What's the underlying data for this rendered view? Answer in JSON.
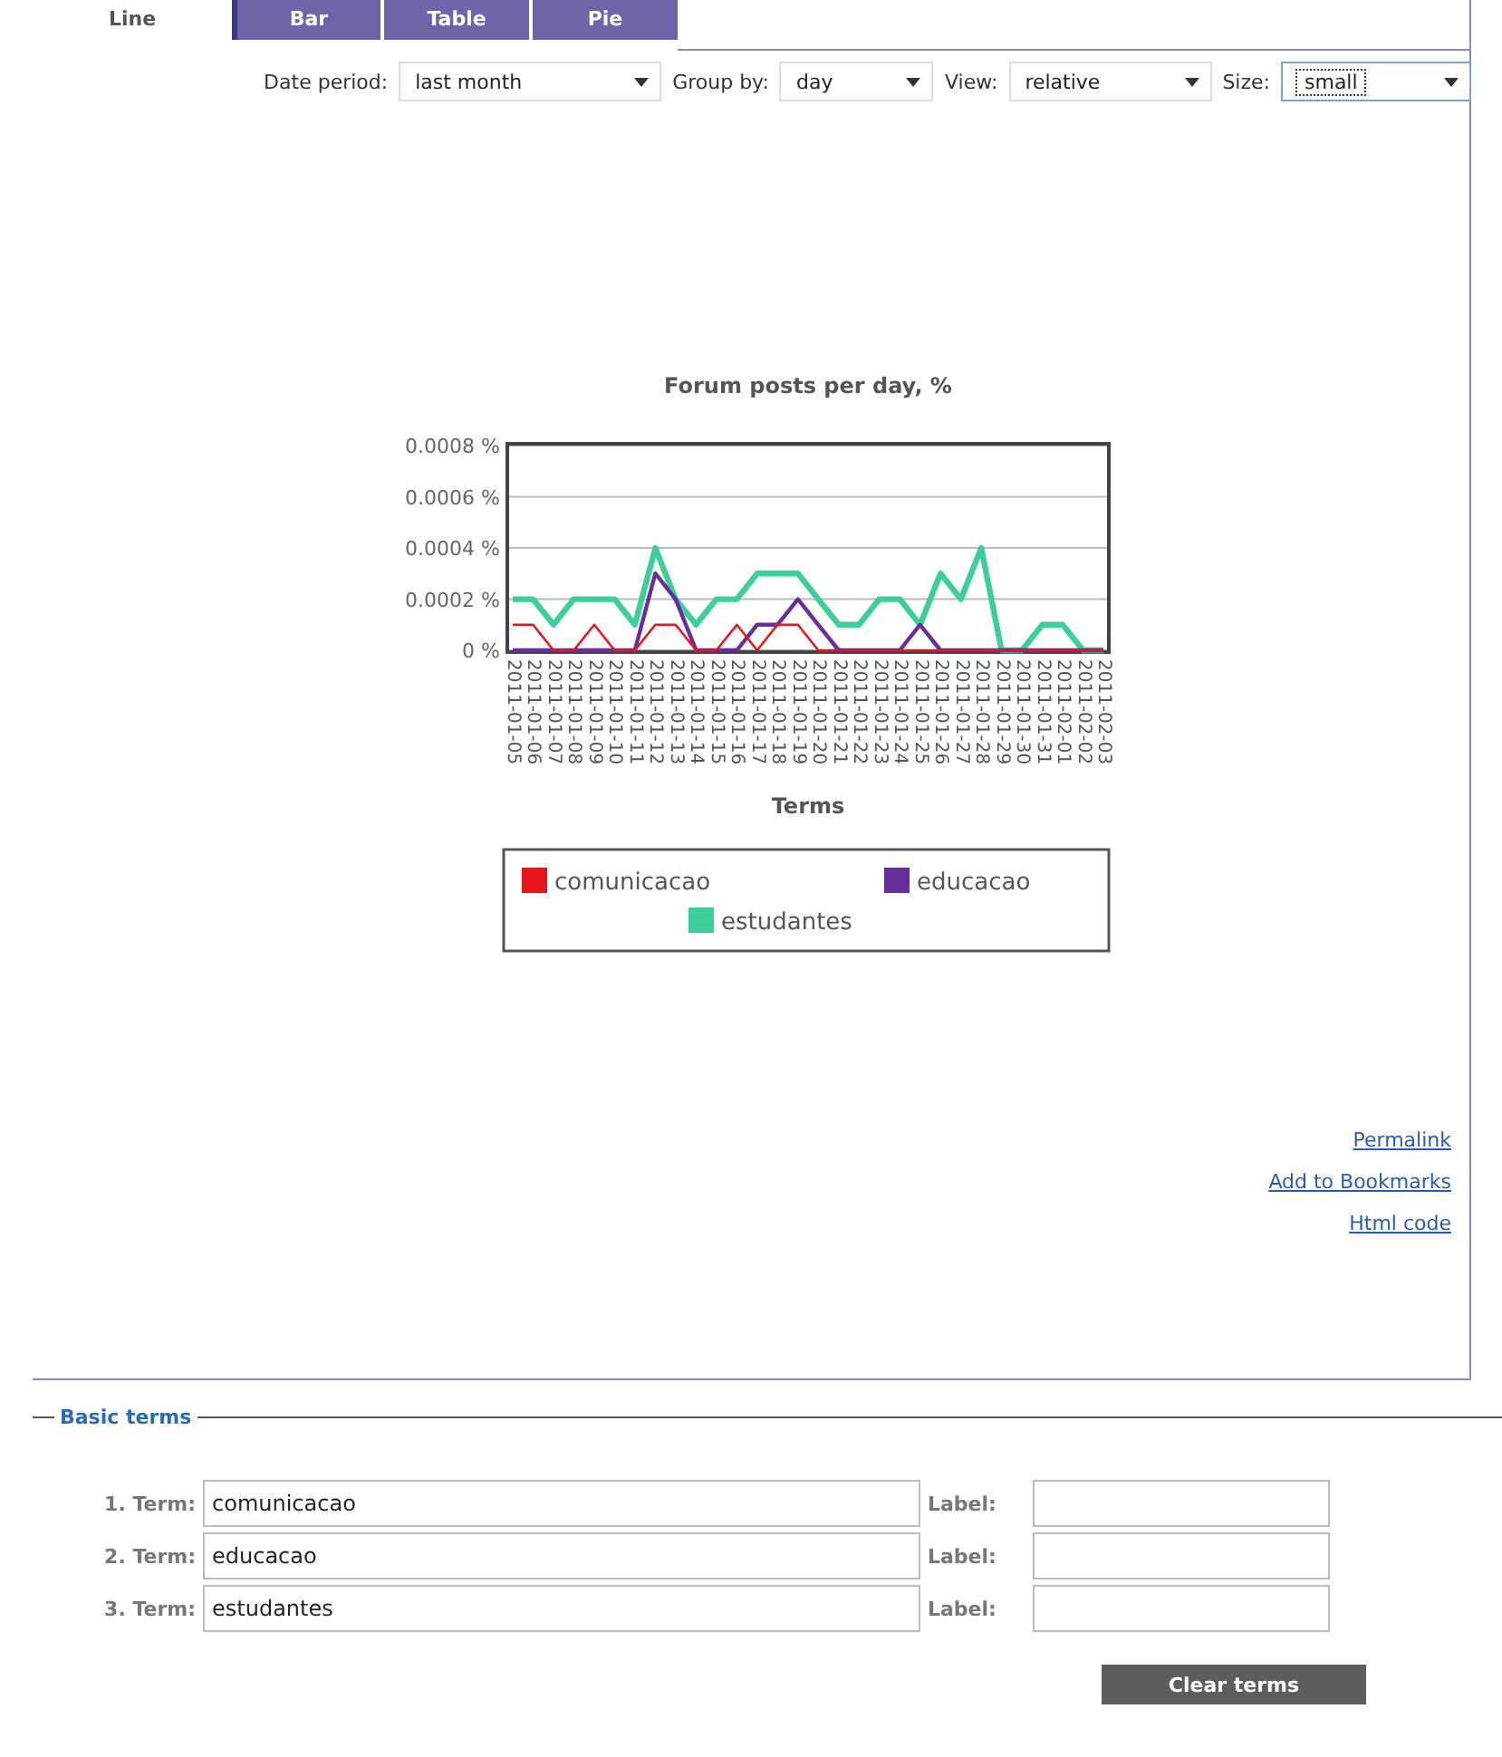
{
  "tabs": [
    {
      "label": "Line",
      "selected": true
    },
    {
      "label": "Bar",
      "selected": false
    },
    {
      "label": "Table",
      "selected": false
    },
    {
      "label": "Pie",
      "selected": false
    }
  ],
  "controls": [
    {
      "label": "Date period:",
      "value": "last month",
      "focused": false
    },
    {
      "label": "Group by:",
      "value": "day",
      "focused": false
    },
    {
      "label": "View:",
      "value": "relative",
      "focused": false
    },
    {
      "label": "Size:",
      "value": "small",
      "focused": true
    }
  ],
  "chart": {
    "chart_data": {
      "type": "line",
      "title": "Forum posts per day, %",
      "xlabel": "Terms",
      "grid": true,
      "legend": true,
      "categories": [
        "2011-01-05",
        "2011-01-06",
        "2011-01-07",
        "2011-01-08",
        "2011-01-09",
        "2011-01-10",
        "2011-01-11",
        "2011-01-12",
        "2011-01-13",
        "2011-01-14",
        "2011-01-15",
        "2011-01-16",
        "2011-01-17",
        "2011-01-18",
        "2011-01-19",
        "2011-01-20",
        "2011-01-21",
        "2011-01-22",
        "2011-01-23",
        "2011-01-24",
        "2011-01-25",
        "2011-01-26",
        "2011-01-27",
        "2011-01-28",
        "2011-01-29",
        "2011-01-30",
        "2011-01-31",
        "2011-02-01",
        "2011-02-02",
        "2011-02-03"
      ],
      "ylim": [
        0,
        0.0008
      ],
      "yticks": [
        {
          "value": 0,
          "label": "0 %"
        },
        {
          "value": 0.0002,
          "label": "0.0002 %"
        },
        {
          "value": 0.0004,
          "label": "0.0004 %"
        },
        {
          "value": 0.0006,
          "label": "0.0006 %"
        },
        {
          "value": 0.0008,
          "label": "0.0008 %"
        }
      ],
      "series": [
        {
          "name": "comunicacao",
          "color": "#e8151b",
          "values": [
            0.0001,
            0.0001,
            0,
            0,
            0.0001,
            0,
            0,
            0.0001,
            0.0001,
            0,
            0,
            0.0001,
            0,
            0.0001,
            0.0001,
            0,
            0,
            0,
            0,
            0,
            0,
            0,
            0,
            0,
            0,
            0,
            0,
            0,
            0,
            0
          ]
        },
        {
          "name": "educacao",
          "color": "#6a2d9c",
          "values": [
            0,
            0,
            0,
            0,
            0,
            0,
            0,
            0.0003,
            0.0002,
            0,
            0,
            0,
            0.0001,
            0.0001,
            0.0002,
            0.0001,
            0,
            0,
            0,
            0,
            0.0001,
            0,
            0,
            0,
            0,
            0,
            0,
            0,
            0,
            0
          ]
        },
        {
          "name": "estudantes",
          "color": "#3ccf9a",
          "values": [
            0.0002,
            0.0002,
            0.0001,
            0.0002,
            0.0002,
            0.0002,
            0.0001,
            0.0004,
            0.0002,
            0.0001,
            0.0002,
            0.0002,
            0.0003,
            0.0003,
            0.0003,
            0.0002,
            0.0001,
            0.0001,
            0.0002,
            0.0002,
            0.0001,
            0.0003,
            0.0002,
            0.0004,
            0,
            0,
            0.0001,
            0.0001,
            0,
            0
          ]
        }
      ]
    }
  },
  "links": [
    "Permalink",
    "Add to Bookmarks",
    "Html code"
  ],
  "basic_terms": {
    "title": "Basic terms",
    "terms": [
      {
        "label": "1. Term:",
        "value": "comunicacao",
        "label_caption": "Label:"
      },
      {
        "label": "2. Term:",
        "value": "educacao",
        "label_caption": "Label:"
      },
      {
        "label": "3. Term:",
        "value": "estudantes",
        "label_caption": "Label:"
      }
    ],
    "button": "Clear terms"
  }
}
